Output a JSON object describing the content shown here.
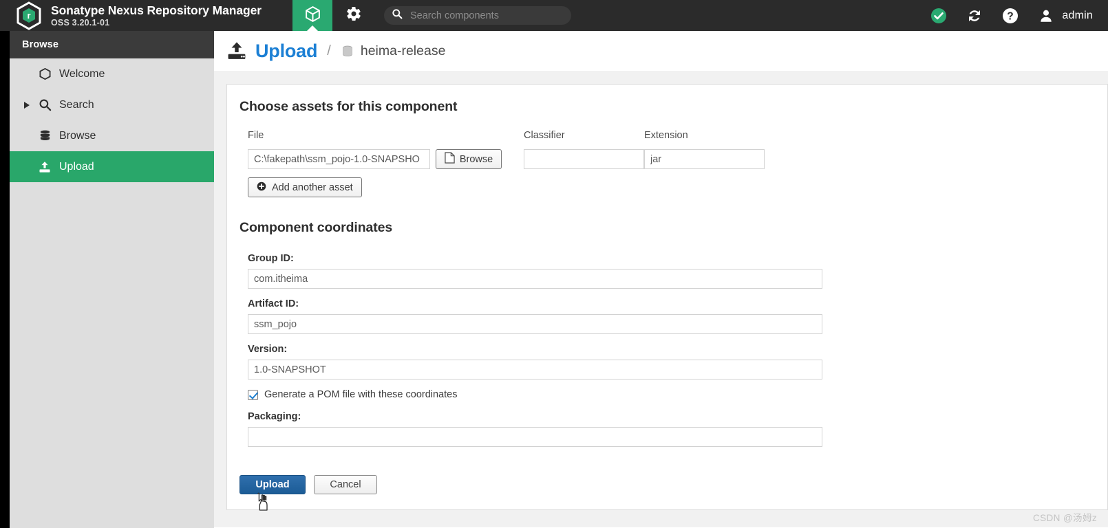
{
  "header": {
    "brand_title": "Sonatype Nexus Repository Manager",
    "brand_version": "OSS 3.20.1-01",
    "logo_icon": "nexus-hexagon-logo-icon",
    "tab_browse_icon": "box-cube-icon",
    "gear_icon": "gear-icon",
    "search": {
      "icon": "search-icon",
      "placeholder": "Search components",
      "value": ""
    },
    "status_icon": "green-check-circle-icon",
    "refresh_icon": "refresh-icon",
    "help_icon": "question-circle-icon",
    "user_icon": "user-avatar-icon",
    "user_name": "admin"
  },
  "sidebar": {
    "section_title": "Browse",
    "items": [
      {
        "label": "Welcome",
        "icon": "hexagon-icon",
        "has_caret": false,
        "selected": false
      },
      {
        "label": "Search",
        "icon": "search-icon",
        "has_caret": true,
        "selected": false
      },
      {
        "label": "Browse",
        "icon": "database-icon",
        "has_caret": false,
        "selected": false
      },
      {
        "label": "Upload",
        "icon": "upload-icon",
        "has_caret": false,
        "selected": true
      }
    ]
  },
  "breadcrumb": {
    "upload_icon": "upload-server-icon",
    "title": "Upload",
    "separator": "/",
    "repo_icon": "database-icon",
    "repository": "heima-release"
  },
  "assets_section": {
    "heading": "Choose assets for this component",
    "columns": {
      "file": "File",
      "classifier": "Classifier",
      "extension": "Extension"
    },
    "file_value": "C:\\fakepath\\ssm_pojo-1.0-SNAPSHO",
    "classifier_value": "",
    "extension_value": "jar",
    "browse_button": "Browse",
    "browse_icon": "file-document-icon",
    "add_asset_button": "Add another asset",
    "add_asset_icon": "plus-circle-icon"
  },
  "coordinates_section": {
    "heading": "Component coordinates",
    "fields": [
      {
        "label": "Group ID:",
        "value": "com.itheima"
      },
      {
        "label": "Artifact ID:",
        "value": "ssm_pojo"
      },
      {
        "label": "Version:",
        "value": "1.0-SNAPSHOT"
      }
    ],
    "generate_pom": {
      "label": "Generate a POM file with these coordinates",
      "checked": true
    },
    "packaging": {
      "label": "Packaging:",
      "value": ""
    }
  },
  "actions": {
    "upload_label": "Upload",
    "cancel_label": "Cancel"
  },
  "watermark": "CSDN @汤姆z",
  "colors": {
    "accent_green": "#29a76a",
    "header_dark": "#2b2b2b",
    "link_blue": "#1b7fd4",
    "button_blue": "#1c5c96"
  }
}
